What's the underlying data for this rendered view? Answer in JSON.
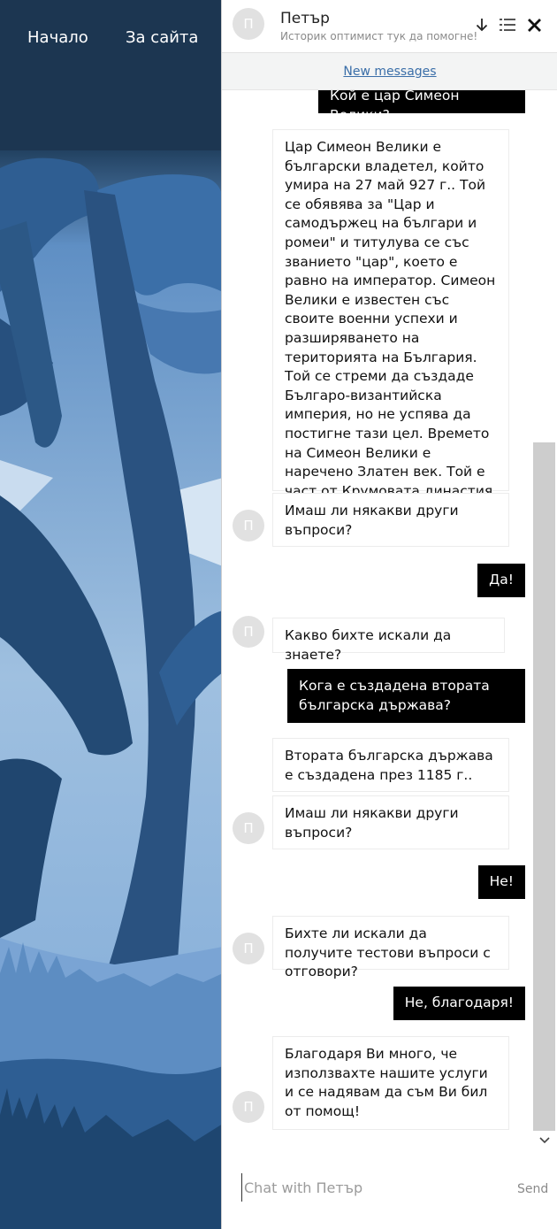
{
  "nav": {
    "home": "Начало",
    "about": "За сайта"
  },
  "header": {
    "avatar_initial": "П",
    "name": "Петър",
    "subtitle": "Историк оптимист тук да помогне!"
  },
  "new_messages_link": "New messages",
  "messages": [
    {
      "from": "user",
      "text": "Кой е цар Симеон Велики?"
    },
    {
      "from": "bot",
      "text": "Цар Симеон Велики е български владетел, който умира на 27 май 927 г.. Той се обявява за \"Цар и самодържец на българи и ромеи\" и титулува се със званието \"цар\", което е равно на император. Симеон Велики е известен със своите военни успехи и разширяването на територията на България. Той се стреми да създаде Българо-византийска империя, но не успява да постигне тази цел. Времето на Симеон Велики е наречено Златен век. Той е част от Крумовата династия и вероятно е част от Дуло."
    },
    {
      "from": "bot",
      "text": "Имаш ли някакви други въпроси?"
    },
    {
      "from": "user",
      "text": "Да!"
    },
    {
      "from": "bot",
      "text": "Какво бихте искали да знаете?"
    },
    {
      "from": "user",
      "text": "Кога е създадена втората българска държава?"
    },
    {
      "from": "bot",
      "text": "Втората българска държава е създадена през 1185 г.."
    },
    {
      "from": "bot",
      "text": "Имаш ли някакви други въпроси?"
    },
    {
      "from": "user",
      "text": "Не!"
    },
    {
      "from": "bot",
      "text": "Бихте ли искали да получите тестови въпроси с отговори?"
    },
    {
      "from": "user",
      "text": "Не, благодаря!"
    },
    {
      "from": "bot",
      "text": "Благодаря Ви много, че използвахте нашите услуги и се надявам да съм Ви бил от помощ!"
    }
  ],
  "input": {
    "placeholder": "Chat with Петър"
  },
  "send_label": "Send",
  "colors": {
    "user_bubble": "#000000",
    "link": "#3a6ea8",
    "bg_dark": "#15304a"
  },
  "icons": [
    "arrow-down-icon",
    "list-icon",
    "close-icon",
    "scroll-down-icon"
  ]
}
